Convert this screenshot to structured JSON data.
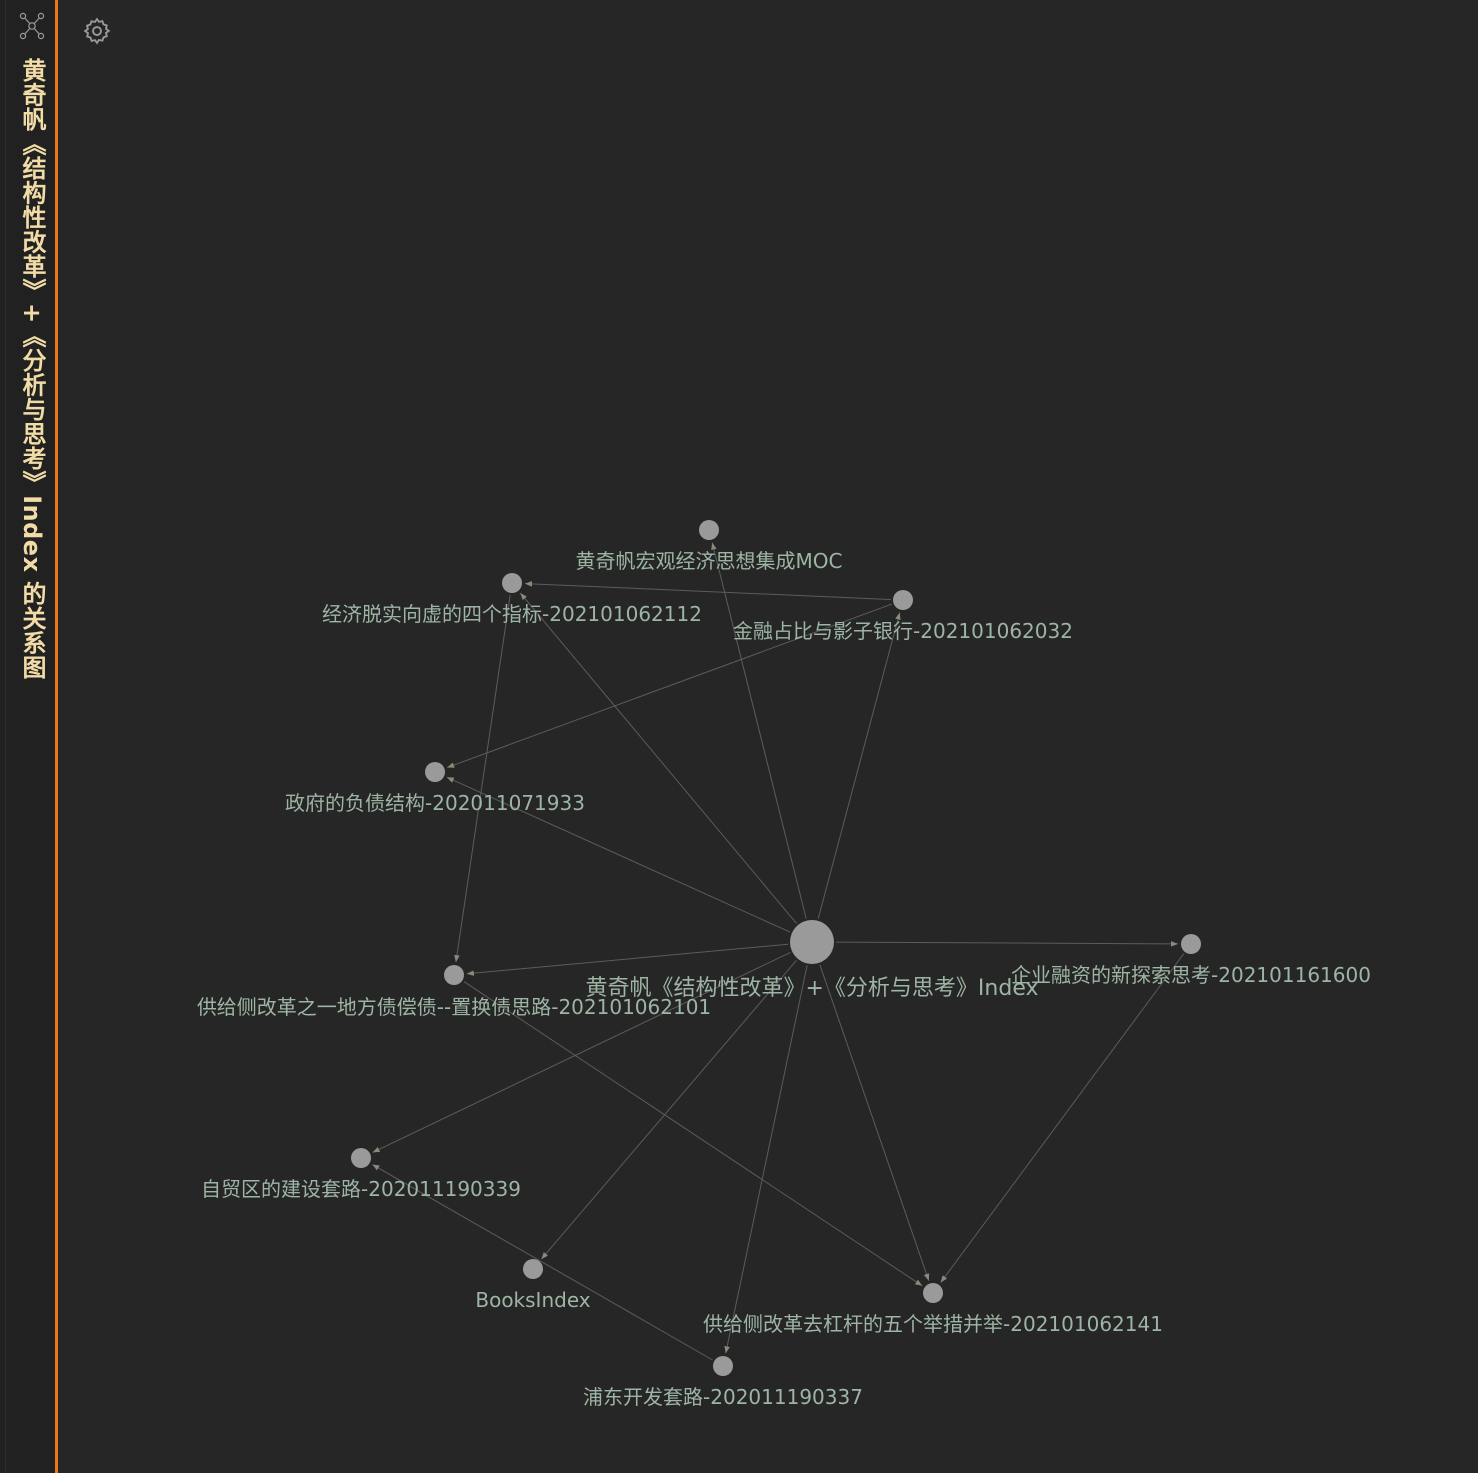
{
  "side_tab": {
    "icon": "graph-icon",
    "title": "黄奇帆《结构性改革》+《分析与思考》Index 的关系图",
    "accent_color": "#e8781e",
    "title_color": "#f1dba6"
  },
  "graph": {
    "settings_icon": "gear-icon",
    "node_color": "#9a9a9a",
    "label_color": "#9db5a4",
    "edge_color": "#5c5c5c",
    "nodes": [
      {
        "id": "center",
        "label": "黄奇帆《结构性改革》+《分析与思考》Index"
      },
      {
        "id": "moc",
        "label": "黄奇帆宏观经济思想集成MOC"
      },
      {
        "id": "jingji",
        "label": "经济脱实向虚的四个指标-202101062112"
      },
      {
        "id": "jinrong",
        "label": "金融占比与影子银行-202101062032"
      },
      {
        "id": "zhengfu",
        "label": "政府的负债结构-202011071933"
      },
      {
        "id": "gongji1",
        "label": "供给侧改革之一地方债偿债--置换债思路-202101062101"
      },
      {
        "id": "qiye",
        "label": "企业融资的新探索思考-202101161600"
      },
      {
        "id": "zimao",
        "label": "自贸区的建设套路-202011190339"
      },
      {
        "id": "books",
        "label": "BooksIndex"
      },
      {
        "id": "gongji2",
        "label": "供给侧改革去杠杆的五个举措并举-202101062141"
      },
      {
        "id": "pudong",
        "label": "浦东开发套路-202011190337"
      }
    ],
    "edges": [
      {
        "from": "center",
        "to": "moc"
      },
      {
        "from": "center",
        "to": "jingji"
      },
      {
        "from": "center",
        "to": "jinrong"
      },
      {
        "from": "center",
        "to": "zhengfu"
      },
      {
        "from": "center",
        "to": "gongji1"
      },
      {
        "from": "center",
        "to": "qiye"
      },
      {
        "from": "center",
        "to": "zimao"
      },
      {
        "from": "center",
        "to": "books"
      },
      {
        "from": "center",
        "to": "gongji2"
      },
      {
        "from": "center",
        "to": "pudong"
      },
      {
        "from": "jinrong",
        "to": "jingji"
      },
      {
        "from": "jinrong",
        "to": "zhengfu"
      },
      {
        "from": "jingji",
        "to": "gongji1"
      },
      {
        "from": "gongji1",
        "to": "gongji2"
      },
      {
        "from": "qiye",
        "to": "gongji2"
      },
      {
        "from": "pudong",
        "to": "zimao"
      }
    ]
  }
}
